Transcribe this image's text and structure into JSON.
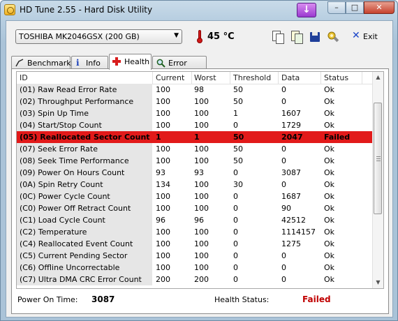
{
  "window": {
    "title": "HD Tune 2.55 - Hard Disk Utility",
    "min_glyph": "–",
    "max_glyph": "□",
    "close_glyph": "✕",
    "download_glyph": "↓"
  },
  "toolbar": {
    "drive": "TOSHIBA MK2046GSX (200 GB)",
    "temperature": "45 °C",
    "exit_label": "Exit",
    "icons": [
      "copy-text-icon",
      "copy-screenshot-icon",
      "save-icon",
      "options-icon",
      "exit-icon"
    ]
  },
  "tabs": [
    {
      "label": "Benchmark",
      "icon": "benchmark-icon"
    },
    {
      "label": "Info",
      "icon": "info-icon"
    },
    {
      "label": "Health",
      "icon": "health-cross-icon",
      "active": true
    },
    {
      "label": "Error Scan",
      "icon": "magnifier-icon"
    }
  ],
  "table": {
    "columns": [
      "ID",
      "Current",
      "Worst",
      "Threshold",
      "Data",
      "Status"
    ],
    "rows": [
      {
        "id": "(01) Raw Read Error Rate",
        "current": "100",
        "worst": "98",
        "threshold": "50",
        "data": "0",
        "status": "Ok"
      },
      {
        "id": "(02) Throughput Performance",
        "current": "100",
        "worst": "100",
        "threshold": "50",
        "data": "0",
        "status": "Ok"
      },
      {
        "id": "(03) Spin Up Time",
        "current": "100",
        "worst": "100",
        "threshold": "1",
        "data": "1607",
        "status": "Ok"
      },
      {
        "id": "(04) Start/Stop Count",
        "current": "100",
        "worst": "100",
        "threshold": "0",
        "data": "1729",
        "status": "Ok"
      },
      {
        "id": "(05) Reallocated Sector Count",
        "current": "1",
        "worst": "1",
        "threshold": "50",
        "data": "2047",
        "status": "Failed",
        "failed": true
      },
      {
        "id": "(07) Seek Error Rate",
        "current": "100",
        "worst": "100",
        "threshold": "50",
        "data": "0",
        "status": "Ok"
      },
      {
        "id": "(08) Seek Time Performance",
        "current": "100",
        "worst": "100",
        "threshold": "50",
        "data": "0",
        "status": "Ok"
      },
      {
        "id": "(09) Power On Hours Count",
        "current": "93",
        "worst": "93",
        "threshold": "0",
        "data": "3087",
        "status": "Ok"
      },
      {
        "id": "(0A) Spin Retry Count",
        "current": "134",
        "worst": "100",
        "threshold": "30",
        "data": "0",
        "status": "Ok"
      },
      {
        "id": "(0C) Power Cycle Count",
        "current": "100",
        "worst": "100",
        "threshold": "0",
        "data": "1687",
        "status": "Ok"
      },
      {
        "id": "(C0) Power Off Retract Count",
        "current": "100",
        "worst": "100",
        "threshold": "0",
        "data": "90",
        "status": "Ok"
      },
      {
        "id": "(C1) Load Cycle Count",
        "current": "96",
        "worst": "96",
        "threshold": "0",
        "data": "42512",
        "status": "Ok"
      },
      {
        "id": "(C2) Temperature",
        "current": "100",
        "worst": "100",
        "threshold": "0",
        "data": "1114157",
        "status": "Ok"
      },
      {
        "id": "(C4) Reallocated Event Count",
        "current": "100",
        "worst": "100",
        "threshold": "0",
        "data": "1275",
        "status": "Ok"
      },
      {
        "id": "(C5) Current Pending Sector",
        "current": "100",
        "worst": "100",
        "threshold": "0",
        "data": "0",
        "status": "Ok"
      },
      {
        "id": "(C6) Offline Uncorrectable",
        "current": "100",
        "worst": "100",
        "threshold": "0",
        "data": "0",
        "status": "Ok"
      },
      {
        "id": "(C7) Ultra DMA CRC Error Count",
        "current": "200",
        "worst": "200",
        "threshold": "0",
        "data": "0",
        "status": "Ok"
      }
    ]
  },
  "footer": {
    "power_on_label": "Power On Time:",
    "power_on_value": "3087",
    "health_label": "Health Status:",
    "health_value": "Failed"
  },
  "colors": {
    "failed_row": "#e21a1a",
    "health_failed_text": "#c00000",
    "id_column_bg": "#e6e6e6"
  }
}
